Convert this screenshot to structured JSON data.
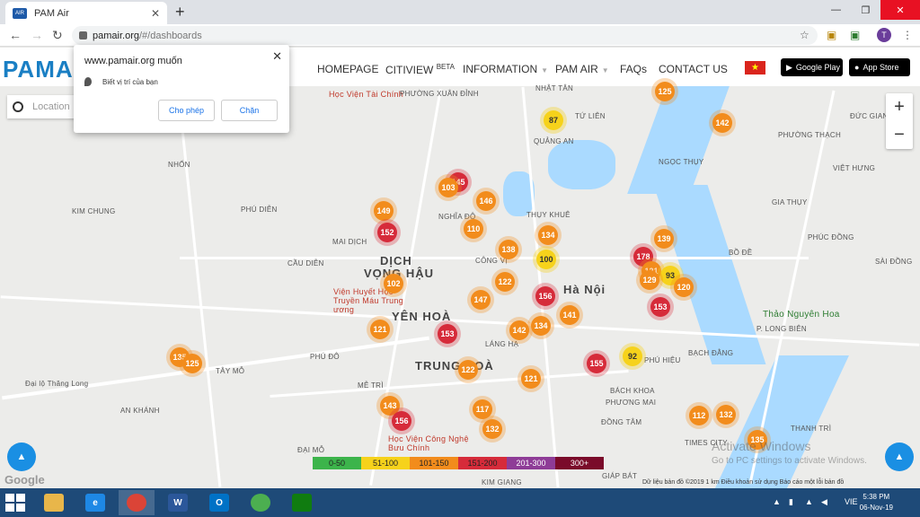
{
  "browser": {
    "tab_title": "PAM Air",
    "tab_favicon": "AIR",
    "new_tab": "+",
    "url_host": "pamair.org",
    "url_path": "/#/dashboards",
    "avatar_letter": "T"
  },
  "site": {
    "logo": "PAMA",
    "menu": {
      "homepage": "HOMEPAGE",
      "cityview": "CITIVIEW",
      "cityview_badge": "BETA",
      "information": "INFORMATION",
      "pamair": "PAM AIR",
      "faqs": "FAQs",
      "contact": "CONTACT US"
    },
    "flag_star": "★",
    "google_play": "Google Play",
    "app_store": "App Store"
  },
  "popup": {
    "title": "www.pamair.org muốn",
    "permission": "Biết vị trí của bạn",
    "allow": "Cho phép",
    "block": "Chặn"
  },
  "map": {
    "location_placeholder": "Location",
    "places": [
      {
        "t": "Học Viện Tài Chính",
        "c": "red"
      },
      {
        "t": "PHƯỜNG XUÂN ĐỈNH"
      },
      {
        "t": "NHẬT TÂN"
      },
      {
        "t": "TỨ LIÊN"
      },
      {
        "t": "QUẢNG AN"
      },
      {
        "t": "PHƯỜNG THẠCH"
      },
      {
        "t": "ĐỨC GIANG"
      },
      {
        "t": "NGỌC THỤY"
      },
      {
        "t": "VIỆT HƯNG"
      },
      {
        "t": "NHỔN"
      },
      {
        "t": "PHÚ DIỄN"
      },
      {
        "t": "KIM CHUNG"
      },
      {
        "t": "NGHĨA ĐÔ"
      },
      {
        "t": "THỤY KHUÊ"
      },
      {
        "t": "GIA THỤY"
      },
      {
        "t": "MAI DỊCH"
      },
      {
        "t": "DỊCH",
        "c": "big"
      },
      {
        "t": "VỌNG HẬU",
        "c": "big"
      },
      {
        "t": "CẦU DIỄN"
      },
      {
        "t": "CÔNG VỊ"
      },
      {
        "t": "PHÚC ĐỒNG"
      },
      {
        "t": "BỒ ĐỀ"
      },
      {
        "t": "SÀI ĐỒNG"
      },
      {
        "t": "Hà Nội",
        "c": "big"
      },
      {
        "t": "Viện Huyết Học Truyền Máu Trung ương",
        "c": "red"
      },
      {
        "t": "YÊN HOÀ",
        "c": "big"
      },
      {
        "t": "Thảo Nguyên Hoa",
        "c": "green"
      },
      {
        "t": "P. LONG BIÊN"
      },
      {
        "t": "PHÚ ĐÔ"
      },
      {
        "t": "TRUNG HOÀ",
        "c": "big"
      },
      {
        "t": "LÁNG HẠ"
      },
      {
        "t": "TÂY MỖ"
      },
      {
        "t": "MỄ TRÌ"
      },
      {
        "t": "BÁCH KHOA"
      },
      {
        "t": "PHÚ HIỆU"
      },
      {
        "t": "BẠCH ĐẰNG"
      },
      {
        "t": "AN KHÁNH"
      },
      {
        "t": "PHƯƠNG MAI"
      },
      {
        "t": "ĐỒNG TÂM"
      },
      {
        "t": "THANH TRÌ"
      },
      {
        "t": "TIMES CITY"
      },
      {
        "t": "ĐẠI MỖ"
      },
      {
        "t": "KIM GIANG"
      },
      {
        "t": "GIÁP BÁT"
      },
      {
        "t": "Học Viện Công Nghệ Bưu Chính",
        "c": "red"
      },
      {
        "t": "Đại lộ Thăng Long"
      }
    ],
    "markers": [
      {
        "v": "125",
        "c": "o"
      },
      {
        "v": "87",
        "c": "y"
      },
      {
        "v": "142",
        "c": "o"
      },
      {
        "v": "145",
        "c": "r"
      },
      {
        "v": "103",
        "c": "o"
      },
      {
        "v": "146",
        "c": "o"
      },
      {
        "v": "149",
        "c": "o"
      },
      {
        "v": "152",
        "c": "r"
      },
      {
        "v": "110",
        "c": "o"
      },
      {
        "v": "134",
        "c": "o"
      },
      {
        "v": "139",
        "c": "o"
      },
      {
        "v": "138",
        "c": "o"
      },
      {
        "v": "100",
        "c": "y"
      },
      {
        "v": "178",
        "c": "r"
      },
      {
        "v": "121",
        "c": "o"
      },
      {
        "v": "93",
        "c": "y"
      },
      {
        "v": "129",
        "c": "o"
      },
      {
        "v": "120",
        "c": "o"
      },
      {
        "v": "102",
        "c": "o"
      },
      {
        "v": "122",
        "c": "o"
      },
      {
        "v": "156",
        "c": "r"
      },
      {
        "v": "147",
        "c": "o"
      },
      {
        "v": "141",
        "c": "o"
      },
      {
        "v": "153",
        "c": "r"
      },
      {
        "v": "121",
        "c": "o"
      },
      {
        "v": "153",
        "c": "r"
      },
      {
        "v": "142",
        "c": "o"
      },
      {
        "v": "134",
        "c": "o"
      },
      {
        "v": "135",
        "c": "o"
      },
      {
        "v": "125",
        "c": "o"
      },
      {
        "v": "92",
        "c": "y"
      },
      {
        "v": "155",
        "c": "r"
      },
      {
        "v": "122",
        "c": "o"
      },
      {
        "v": "121",
        "c": "o"
      },
      {
        "v": "143",
        "c": "o"
      },
      {
        "v": "156",
        "c": "r"
      },
      {
        "v": "117",
        "c": "o"
      },
      {
        "v": "132",
        "c": "o"
      },
      {
        "v": "112",
        "c": "o"
      },
      {
        "v": "132",
        "c": "o"
      },
      {
        "v": "135",
        "c": "o"
      }
    ],
    "legend": [
      {
        "label": "0-50",
        "color": "#3cb44b"
      },
      {
        "label": "51-100",
        "color": "#f6d21b"
      },
      {
        "label": "101-150",
        "color": "#f28c1c"
      },
      {
        "label": "151-200",
        "color": "#d62b3a"
      },
      {
        "label": "201-300",
        "color": "#8e3c97"
      },
      {
        "label": "300+",
        "color": "#7a0b2a"
      }
    ],
    "google": "Google",
    "attribution": "Dữ liệu bản đồ ©2019   1 km   Điều khoản sử dụng   Báo cáo một lỗi bản đồ",
    "watermark_title": "Activate Windows",
    "watermark_sub": "Go to PC settings to activate Windows."
  },
  "taskbar": {
    "time": "5:38 PM",
    "date": "06-Nov-19",
    "lang": "VIE"
  }
}
